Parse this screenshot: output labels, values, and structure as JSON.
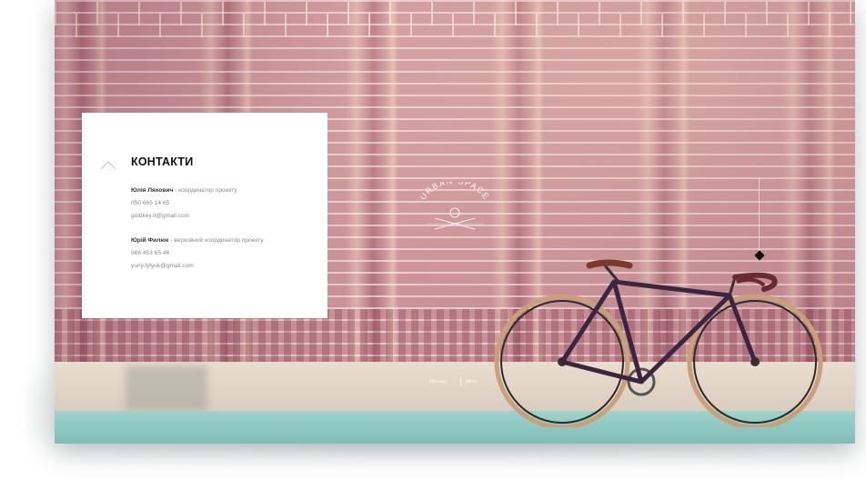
{
  "logo": {
    "text": "URBAN SPACE"
  },
  "contacts": {
    "title": "КОНТАКТИ",
    "people": [
      {
        "name": "Юлія Ляхович",
        "role": " - координатор проекту",
        "phone": "050 665 14 65",
        "email": "goldkey.if@gmail.com"
      },
      {
        "name": "Юрій Филюк",
        "role": " - верховний координатор проекту",
        "phone": "066 453 65 46",
        "email": "yuriy.fylyuk@gmail.com"
      }
    ]
  },
  "footer_nav": {
    "left": "Про нас",
    "right": "Місто"
  },
  "colors": {
    "card_bg": "#ffffff",
    "title": "#111111",
    "muted_text": "#8a8a8a"
  },
  "icons": {
    "card_arrow": "chevron-up-icon",
    "map_pin": "diamond-pin-icon",
    "logo_mark": "urban-space-logo"
  }
}
